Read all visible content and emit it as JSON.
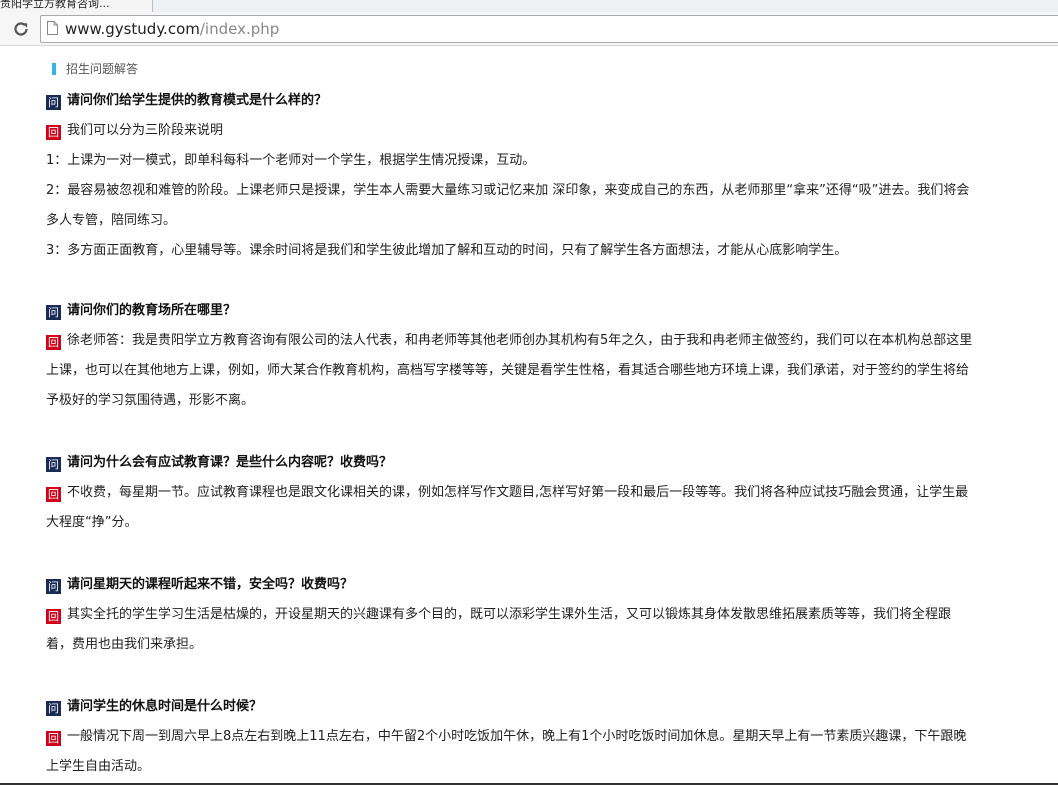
{
  "browser": {
    "tab_title": "贵阳学立方教育咨询...",
    "url_host": "www.gystudy.com",
    "url_path": "/index.php"
  },
  "section": {
    "title": "招生问题解答"
  },
  "badges": {
    "question": "问",
    "answer": "回"
  },
  "qa": [
    {
      "question": "请问你们给学生提供的教育模式是什么样的？",
      "answer_lines": [
        "我们可以分为三阶段来说明",
        "1：上课为一对一模式，即单科每科一个老师对一个学生，根据学生情况授课，互动。",
        "2：最容易被忽视和难管的阶段。上课老师只是授课，学生本人需要大量练习或记忆来加 深印象，来变成自己的东西，从老师那里“拿来”还得“吸”进去。我们将会",
        "多人专管，陪同练习。",
        "3：多方面正面教育，心里辅导等。课余时间将是我们和学生彼此增加了解和互动的时间，只有了解学生各方面想法，才能从心底影响学生。"
      ]
    },
    {
      "question": "请问你们的教育场所在哪里？",
      "answer_lines": [
        "徐老师答：我是贵阳学立方教育咨询有限公司的法人代表，和冉老师等其他老师创办其机构有5年之久，由于我和冉老师主做签约，我们可以在本机构总部这里",
        "上课，也可以在其他地方上课，例如，师大某合作教育机构，高档写字楼等等，关键是看学生性格，看其适合哪些地方环境上课，我们承诺，对于签约的学生将给",
        "予极好的学习氛围待遇，形影不离。"
      ]
    },
    {
      "question": "请问为什么会有应试教育课？是些什么内容呢？收费吗？",
      "answer_lines": [
        "不收费，每星期一节。应试教育课程也是跟文化课相关的课，例如怎样写作文题目,怎样写好第一段和最后一段等等。我们将各种应试技巧融会贯通，让学生最",
        "大程度“挣”分。"
      ]
    },
    {
      "question": "请问星期天的课程听起来不错，安全吗？收费吗？",
      "answer_lines": [
        "其实全托的学生学习生活是枯燥的，开设星期天的兴趣课有多个目的，既可以添彩学生课外生活，又可以锻炼其身体发散思维拓展素质等等，我们将全程跟",
        "着，费用也由我们来承担。"
      ]
    },
    {
      "question": "请问学生的休息时间是什么时候？",
      "answer_lines": [
        "一般情况下周一到周六早上8点左右到晚上11点左右，中午留2个小时吃饭加午休，晚上有1个小时吃饭时间加休息。星期天早上有一节素质兴趣课，下午跟晚",
        "上学生自由活动。"
      ]
    }
  ]
}
